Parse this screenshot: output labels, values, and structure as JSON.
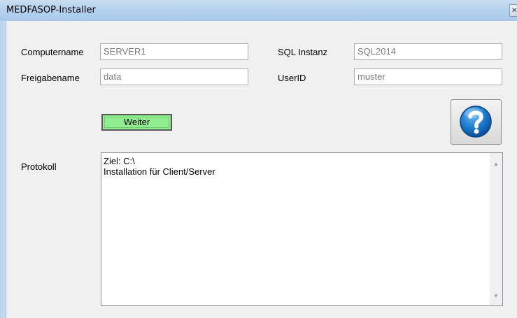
{
  "window": {
    "title": "MEDFASOP-Installer",
    "close_glyph": "✕"
  },
  "form": {
    "computername_label": "Computername",
    "computername_value": "SERVER1",
    "freigabename_label": "Freigabename",
    "freigabename_value": "data",
    "sql_instanz_label": "SQL Instanz",
    "sql_instanz_value": "SQL2014",
    "userid_label": "UserID",
    "userid_value": "muster"
  },
  "actions": {
    "weiter_label": "Weiter",
    "weiter_color": "#90ee90",
    "help_icon": "help-question-icon",
    "help_color": "#1f7fd0"
  },
  "protocol": {
    "label": "Protokoll",
    "lines": [
      "Ziel: C:\\",
      "Installation für Client/Server"
    ],
    "line_1": "Ziel: C:\\",
    "line_2": "Installation für Client/Server",
    "scroll_up": "▲",
    "scroll_down": "▼"
  }
}
